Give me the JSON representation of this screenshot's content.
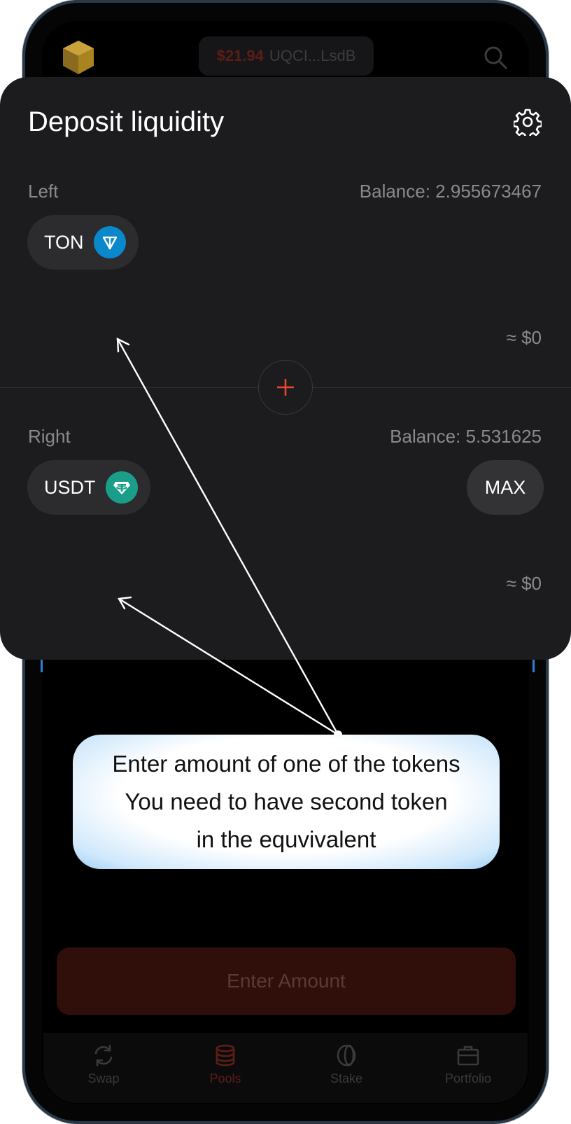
{
  "header": {
    "wallet_balance": "$21.94",
    "wallet_address": "UQCI...LsdB",
    "icons": [
      "cube-avatar-icon",
      "search-icon"
    ]
  },
  "card": {
    "title": "Deposit liquidity",
    "settings_icon": "gear-icon",
    "left": {
      "label": "Left",
      "balance": "Balance: 2.955673467",
      "token": "TON",
      "usd_value": "≈ $0"
    },
    "right": {
      "label": "Right",
      "balance": "Balance: 5.531625",
      "token": "USDT",
      "usd_value": "≈ $0",
      "max_label": "MAX"
    },
    "add_icon": "plus-icon"
  },
  "callout": {
    "line1": "Enter amount of one of the tokens",
    "line2": "You need to have second token",
    "line3": "in the equvivalent"
  },
  "enter_button": "Enter Amount",
  "nav": {
    "items": [
      {
        "label": "Swap",
        "icon": "swap-icon"
      },
      {
        "label": "Pools",
        "icon": "pools-icon",
        "active": true
      },
      {
        "label": "Stake",
        "icon": "stake-icon"
      },
      {
        "label": "Portfolio",
        "icon": "briefcase-icon"
      }
    ]
  },
  "colors": {
    "accent": "#e8462f",
    "card_bg": "#1c1c1e",
    "ton_blue": "#0a88cc",
    "usdt_teal": "#1a9e8a"
  }
}
